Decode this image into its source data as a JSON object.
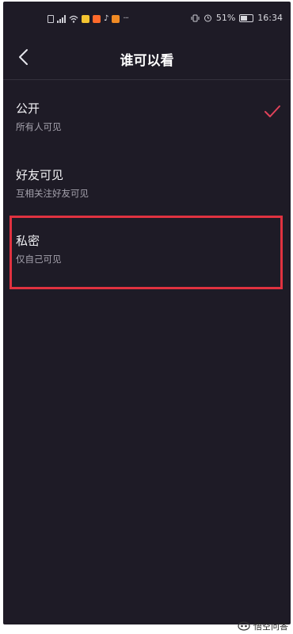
{
  "status": {
    "left_icons": [
      "sim-icon",
      "signal-icon",
      "wifi-icon",
      "app-icon",
      "app-icon",
      "tiktok-icon",
      "app-icon",
      "more-icon"
    ],
    "battery_text": "51%",
    "time": "16:34"
  },
  "nav": {
    "title": "谁可以看"
  },
  "options": [
    {
      "label": "公开",
      "desc": "所有人可见",
      "selected": true
    },
    {
      "label": "好友可见",
      "desc": "互相关注好友可见",
      "selected": false
    },
    {
      "label": "私密",
      "desc": "仅自己可见",
      "selected": false
    }
  ],
  "colors": {
    "background": "#1e1b26",
    "check": "#e0425a",
    "highlight": "#e03240"
  },
  "watermark": {
    "text": "悟空问答"
  }
}
